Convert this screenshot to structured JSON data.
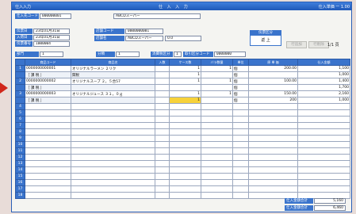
{
  "window": {
    "title_left": "仕入入力",
    "title_center": "仕 入 入 力",
    "title_right": "仕入単価 ー 1.00"
  },
  "header": {
    "supplier_code_label": "仕入先コード",
    "supplier_code": "000000001",
    "supplier_name": "ABCDスーパー",
    "date_label": "伝票日",
    "date": "23年01月31日",
    "entry_date_label": "入荷日",
    "entry_date": "23年01月31日",
    "slip_no_label": "伝票番号",
    "slip_no": "1000004",
    "store_code_label": "店舗コード",
    "store_code": "0000000001",
    "store_name_label": "店舗名",
    "store_name": "ABCDスーパー",
    "store_extra": "0.0",
    "dept_label": "部門",
    "dept_value": "1",
    "class_label": "分類",
    "class_value": "1",
    "tax_label": "消費税区分",
    "tax_value": "1",
    "voucher_code_label": "取引区分コード",
    "voucher_code": "0000000"
  },
  "buttons": {
    "return_head": "伝票区分",
    "return_body": "返 上",
    "ghost1": "行追加",
    "ghost2": "行削除",
    "page_indicator": "1/1  頁"
  },
  "table": {
    "headers": [
      "",
      "商品コード",
      "商品名",
      "入数",
      "ケース数",
      "バラ数量",
      "単位",
      "原 単 価",
      "仕入金額"
    ],
    "rows": [
      {
        "no": "1",
        "code": "0000000000001",
        "name": "オリジナルラーメン ２リク",
        "qty1": "",
        "qty2": "1",
        "qty3": "1",
        "unit": "個",
        "price": "200.00",
        "amount": "1,100"
      },
      {
        "no": "",
        "code": "  ［ 課 税 ］",
        "name": "関税",
        "qty1": "",
        "qty2": "1",
        "qty3": "",
        "unit": "個",
        "price": "",
        "amount": "1,000"
      },
      {
        "no": "2",
        "code": "0000000000002",
        "name": "オリジナルスープ ２，５合57",
        "qty1": "",
        "qty2": "1",
        "qty3": "1",
        "unit": "個",
        "price": "100.00",
        "amount": "1,400"
      },
      {
        "no": "",
        "code": "  ［ 課 税 ］",
        "name": "",
        "qty1": "",
        "qty2": "",
        "qty3": "",
        "unit": "個",
        "price": "",
        "amount": "1,700"
      },
      {
        "no": "3",
        "code": "0000000000003",
        "name": "オリジナルジュース ３１，０ｇ",
        "qty1": "",
        "qty2": "1",
        "qty3": "1",
        "unit": "個",
        "price": "150.00",
        "amount": "2,160"
      },
      {
        "no": "",
        "code": "  ［ 課 税 ］",
        "name": "",
        "qty1": "",
        "qty2": "1",
        "qty3": "",
        "unit": "個",
        "price": "200",
        "amount": "1,000"
      },
      {
        "no": "4",
        "code": "",
        "name": "",
        "qty1": "",
        "qty2": "",
        "qty3": "",
        "unit": "",
        "price": "",
        "amount": ""
      },
      {
        "no": "5",
        "code": "",
        "name": "",
        "qty1": "",
        "qty2": "",
        "qty3": "",
        "unit": "",
        "price": "",
        "amount": ""
      },
      {
        "no": "6",
        "code": "",
        "name": "",
        "qty1": "",
        "qty2": "",
        "qty3": "",
        "unit": "",
        "price": "",
        "amount": ""
      },
      {
        "no": "7",
        "code": "",
        "name": "",
        "qty1": "",
        "qty2": "",
        "qty3": "",
        "unit": "",
        "price": "",
        "amount": ""
      },
      {
        "no": "8",
        "code": "",
        "name": "",
        "qty1": "",
        "qty2": "",
        "qty3": "",
        "unit": "",
        "price": "",
        "amount": ""
      },
      {
        "no": "9",
        "code": "",
        "name": "",
        "qty1": "",
        "qty2": "",
        "qty3": "",
        "unit": "",
        "price": "",
        "amount": ""
      },
      {
        "no": "10",
        "code": "",
        "name": "",
        "qty1": "",
        "qty2": "",
        "qty3": "",
        "unit": "",
        "price": "",
        "amount": ""
      },
      {
        "no": "11",
        "code": "",
        "name": "",
        "qty1": "",
        "qty2": "",
        "qty3": "",
        "unit": "",
        "price": "",
        "amount": ""
      },
      {
        "no": "12",
        "code": "",
        "name": "",
        "qty1": "",
        "qty2": "",
        "qty3": "",
        "unit": "",
        "price": "",
        "amount": ""
      },
      {
        "no": "13",
        "code": "",
        "name": "",
        "qty1": "",
        "qty2": "",
        "qty3": "",
        "unit": "",
        "price": "",
        "amount": ""
      },
      {
        "no": "14",
        "code": "",
        "name": "",
        "qty1": "",
        "qty2": "",
        "qty3": "",
        "unit": "",
        "price": "",
        "amount": ""
      },
      {
        "no": "15",
        "code": "",
        "name": "",
        "qty1": "",
        "qty2": "",
        "qty3": "",
        "unit": "",
        "price": "",
        "amount": ""
      },
      {
        "no": "16",
        "code": "",
        "name": "",
        "qty1": "",
        "qty2": "",
        "qty3": "",
        "unit": "",
        "price": "",
        "amount": ""
      },
      {
        "no": "17",
        "code": "",
        "name": "",
        "qty1": "",
        "qty2": "",
        "qty3": "",
        "unit": "",
        "price": "",
        "amount": ""
      },
      {
        "no": "18",
        "code": "",
        "name": "",
        "qty1": "",
        "qty2": "",
        "qty3": "",
        "unit": "",
        "price": "",
        "amount": ""
      }
    ]
  },
  "totals": {
    "subtotal_label": "仕入金額合計",
    "subtotal_value": "5,160",
    "grand_label": "仕入金額合計",
    "grand_value": "6,460"
  },
  "colors": {
    "accent": "#3a74cc",
    "highlight": "#f7d23a",
    "arrow": "#d0261a"
  }
}
